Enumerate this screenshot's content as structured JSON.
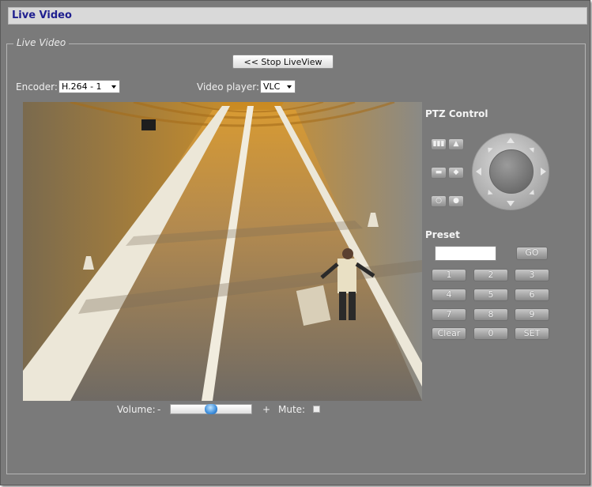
{
  "window": {
    "title": "Live Video"
  },
  "section": {
    "legend": "Live Video"
  },
  "toolbar": {
    "stop_label": "<< Stop LiveView"
  },
  "encoder": {
    "label": "Encoder:",
    "value": "H.264 - 1"
  },
  "player": {
    "label": "Video player:",
    "value": "VLC"
  },
  "ptz": {
    "title": "PTZ Control",
    "buttons": [
      {
        "name": "zoom-out-button",
        "icon": "zoom-out-icon",
        "glyph": "▮▮▮"
      },
      {
        "name": "zoom-in-button",
        "icon": "zoom-in-icon",
        "glyph": "▲"
      },
      {
        "name": "focus-far-button",
        "icon": "focus-far-icon",
        "glyph": "▬"
      },
      {
        "name": "focus-near-button",
        "icon": "focus-near-icon",
        "glyph": "◆"
      },
      {
        "name": "iris-close-button",
        "icon": "iris-close-icon",
        "glyph": "○"
      },
      {
        "name": "iris-open-button",
        "icon": "iris-open-icon",
        "glyph": "●"
      }
    ]
  },
  "preset": {
    "title": "Preset",
    "go_label": "GO",
    "keys": [
      "1",
      "2",
      "3",
      "4",
      "5",
      "6",
      "7",
      "8",
      "9",
      "Clear",
      "0",
      "SET"
    ]
  },
  "controls": {
    "volume_label": "Volume:",
    "volume_minus": "-",
    "volume_plus": "+",
    "mute_label": "Mute:",
    "volume_level": 0.5
  },
  "colors": {
    "title_text": "#1f1f8f",
    "panel_bg": "#7a7a7a",
    "slider_knob": "#3f8fdc"
  }
}
